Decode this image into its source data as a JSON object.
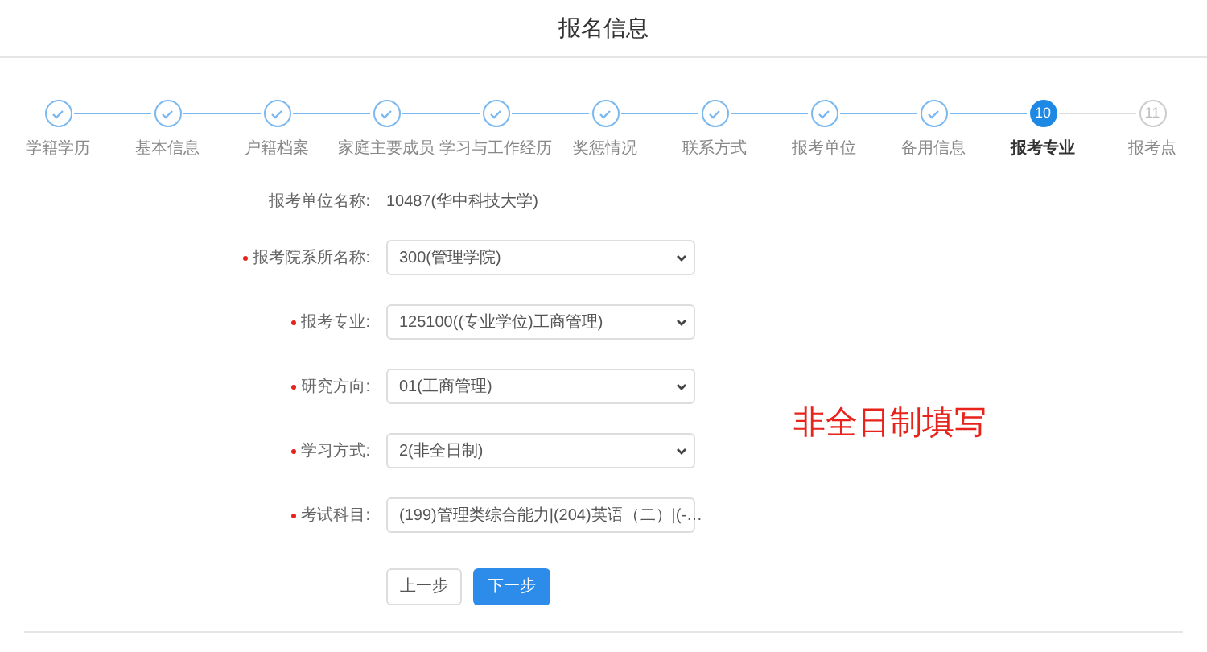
{
  "title": "报名信息",
  "steps": [
    {
      "label": "学籍学历",
      "done": true,
      "selected": false
    },
    {
      "label": "基本信息",
      "done": true,
      "selected": false
    },
    {
      "label": "户籍档案",
      "done": true,
      "selected": false
    },
    {
      "label": "家庭主要成员",
      "done": true,
      "selected": false
    },
    {
      "label": "学习与工作经历",
      "done": true,
      "selected": false
    },
    {
      "label": "奖惩情况",
      "done": true,
      "selected": false
    },
    {
      "label": "联系方式",
      "done": true,
      "selected": false
    },
    {
      "label": "报考单位",
      "done": true,
      "selected": false
    },
    {
      "label": "备用信息",
      "done": true,
      "selected": false
    },
    {
      "number": "10",
      "label": "报考专业",
      "done": false,
      "selected": true
    },
    {
      "number": "11",
      "label": "报考点",
      "done": false,
      "selected": false
    }
  ],
  "fields": [
    {
      "kind": "text",
      "label": "报考单位名称:",
      "required": false,
      "value": "10487(华中科技大学)"
    },
    {
      "kind": "select",
      "label": "报考院系所名称:",
      "required": true,
      "value": "300(管理学院)"
    },
    {
      "kind": "select",
      "label": "报考专业:",
      "required": true,
      "value": "125100((专业学位)工商管理)"
    },
    {
      "kind": "select",
      "label": "研究方向:",
      "required": true,
      "value": "01(工商管理)"
    },
    {
      "kind": "select",
      "label": "学习方式:",
      "required": true,
      "value": "2(非全日制)"
    },
    {
      "kind": "select",
      "label": "考试科目:",
      "required": true,
      "value": "(199)管理类综合能力|(204)英语（二）|(-…"
    }
  ],
  "buttons": [
    {
      "label": "上一步",
      "kind": "secondary"
    },
    {
      "label": "下一步",
      "kind": "primary"
    }
  ],
  "annotation": "非全日制填写"
}
